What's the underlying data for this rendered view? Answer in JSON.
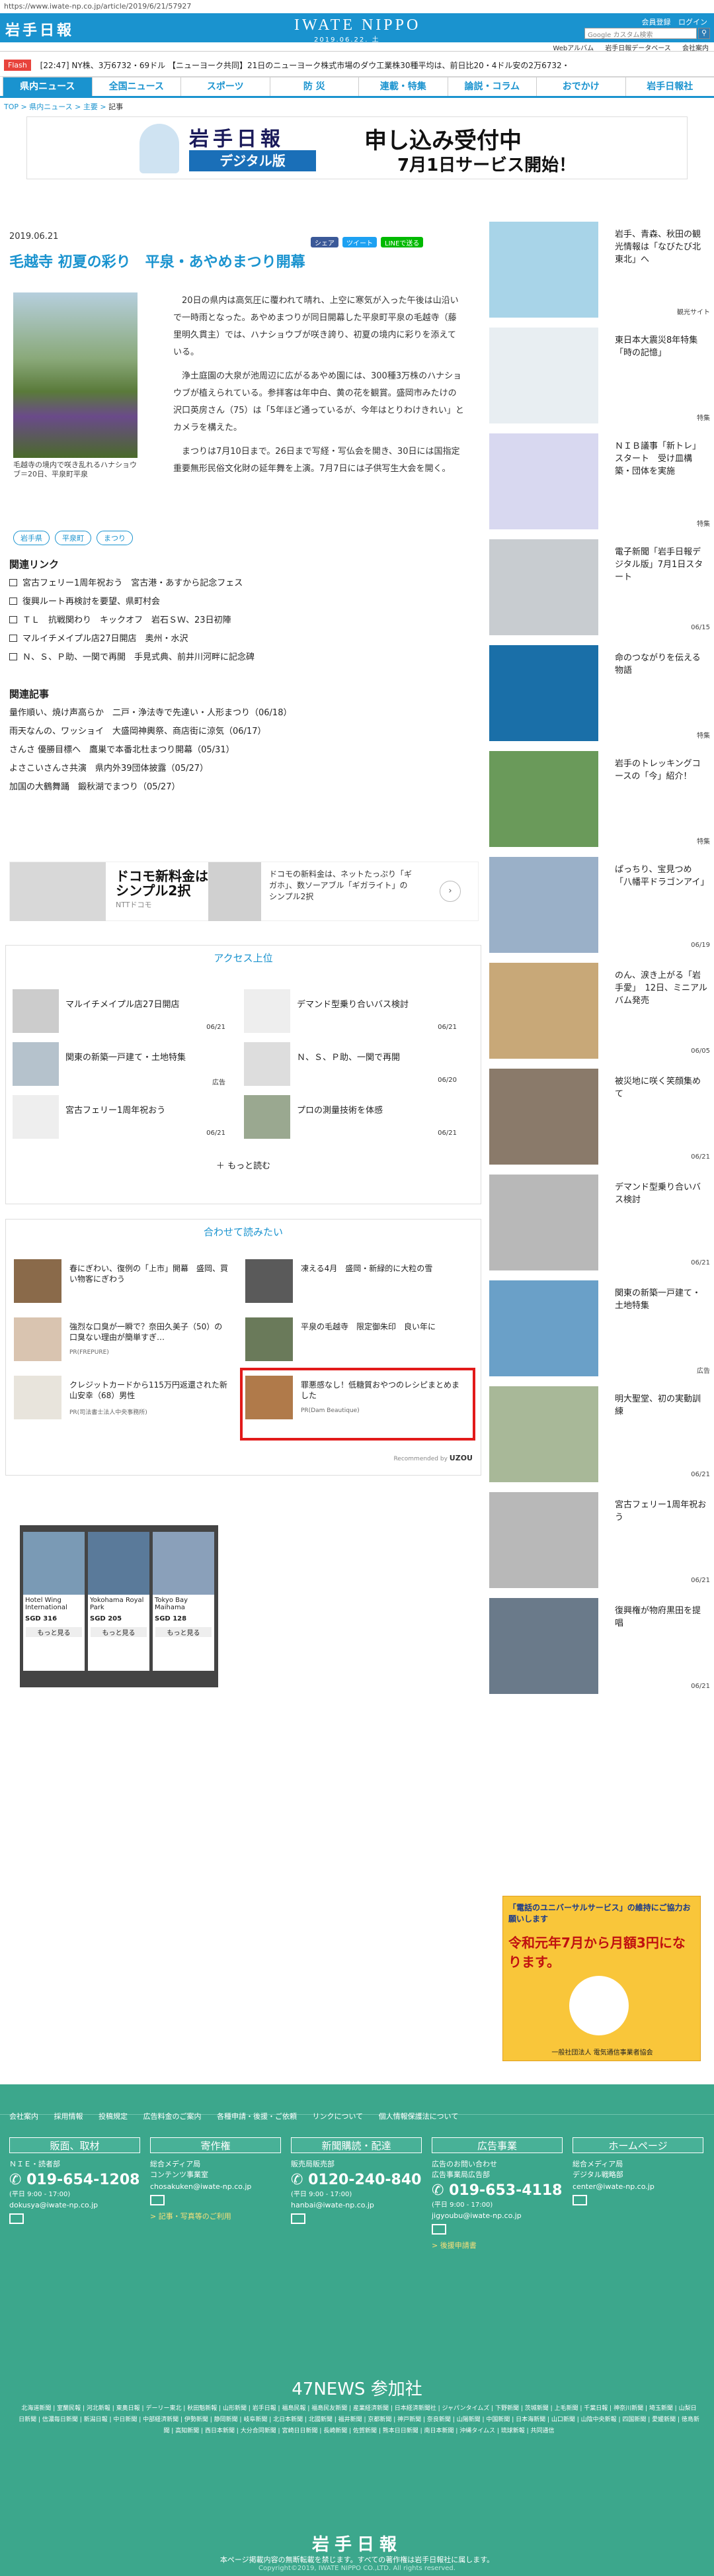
{
  "url": "https://www.iwate-np.co.jp/article/2019/6/21/57927",
  "header": {
    "logo": "岩手日報",
    "site_name": "IWATE NIPPO",
    "site_date": "2019.06.22. 土",
    "links": [
      "会員登録",
      "ログイン"
    ],
    "search_placeholder": "Google カスタム検索",
    "subnav": [
      "Webアルバム",
      "岩手日報データベース",
      "会社案内"
    ]
  },
  "ticker": {
    "flash": "Flash",
    "text": "[22:47] NY株、3万6732・69ドル 【ニューヨーク共同】21日のニューヨーク株式市場のダウ工業株30種平均は、前日比20・4ドル安の2万6732・"
  },
  "gnav": [
    "県内ニュース",
    "全国ニュース",
    "スポーツ",
    "防 災",
    "連載・特集",
    "論説・コラム",
    "おでかけ",
    "岩手日報社"
  ],
  "breadcrumb": {
    "items": [
      "TOP",
      "県内ニュース",
      "主要"
    ],
    "current": "記事"
  },
  "banner": {
    "logo": "岩手日報",
    "sub": "デジタル版",
    "headline": "申し込み受付中",
    "headline2": "7月1日サービス開始！"
  },
  "article": {
    "date": "2019.06.21",
    "share": [
      "シェア",
      "ツイート",
      "LINEで送る"
    ],
    "title": "毛越寺 初夏の彩り　平泉・あやめまつり開幕",
    "caption": "毛越寺の境内で咲き乱れるハナショウブ＝20日、平泉町平泉",
    "body": [
      "20日の県内は高気圧に覆われて晴れ、上空に寒気が入った午後は山沿いで一時雨となった。あやめまつりが同日開幕した平泉町平泉の毛越寺（藤里明久貫主）では、ハナショウブが咲き誇り、初夏の境内に彩りを添えている。",
      "浄土庭園の大泉が池周辺に広がるあやめ園には、300種3万株のハナショウブが植えられている。参拝客は年中白、黄の花を観賞。盛岡市みたけの沢口英房さん（75）は「5年ほど通っているが、今年はとりわけきれい」とカメラを構えた。",
      "まつりは7月10日まで。26日まで写経・写仏会を開き、30日には国指定重要無形民俗文化財の延年舞を上演。7月7日には子供写生大会を開く。"
    ],
    "tags": [
      "岩手県",
      "平泉町",
      "まつり"
    ]
  },
  "related_links": {
    "title": "関連リンク",
    "items": [
      "宮古フェリー1周年祝おう　宮古港・あすから記念フェス",
      "復興ルート再検討を要望、県町村会",
      "ＴＬ　抗戦関わり　キックオフ　岩石ＳＷ、23日初陣",
      "マルイチメイプル店27日開店　奥州・水沢",
      "Ｎ、Ｓ、Ｐ助、一関で再開　手見式典、前井川河畔に記念碑"
    ]
  },
  "related_articles": {
    "title": "関連記事",
    "items": [
      "量作順い、焼け声高らか　二戸・浄法寺で先達い・人形まつり（06/18）",
      "雨天なんの、ワッショイ　大盛岡神輿祭、商店街に涼気（06/17）",
      "さんさ 優勝目標へ　鷹巣で本番北杜まつり開幕（05/31）",
      "よさこいさんさ共演　県内外39団体披露（05/27）",
      "加国の大鶴舞踊　鍛秋湖でまつり（05/27）"
    ]
  },
  "ad": {
    "title": "ドコモ新料金は\nシンプル2択",
    "sponsor": "NTTドコモ",
    "right": "ドコモの新料金は、ネットたっぷり「ギガホ」、数ソーアブル「ギガライト」のシンプル2択"
  },
  "access": {
    "title": "アクセス上位",
    "items": [
      {
        "title": "マルイチメイプル店27日開店",
        "date": "06/21"
      },
      {
        "title": "デマンド型乗り合いバス検討",
        "date": "06/21"
      },
      {
        "title": "関東の新築一戸建て・土地特集",
        "date": "広告"
      },
      {
        "title": "Ｎ、Ｓ、Ｐ助、一関で再開",
        "date": "06/20"
      },
      {
        "title": "宮古フェリー1周年祝おう",
        "date": "06/21"
      },
      {
        "title": "プロの測量技術を体感",
        "date": "06/21"
      }
    ],
    "more": "もっと読む"
  },
  "recommend": {
    "title": "合わせて読みたい",
    "items": [
      {
        "title": "春にぎわい、復例の「上市」開幕　盛岡、買い物客にぎわう",
        "pr": ""
      },
      {
        "title": "凍える4月　盛岡・新緑的に大粒の雪",
        "pr": ""
      },
      {
        "title": "強烈な口臭が一瞬で？奈田久美子（50）の口臭ない理由が簡単すぎ…",
        "pr": "PR(FREPURE)"
      },
      {
        "title": "平泉の毛越寺　限定御朱印　良い年に",
        "pr": ""
      },
      {
        "title": "クレジットカードから115万円返還された新山安幸（68）男性",
        "pr": "PR(司法書士法人中央事務所)"
      },
      {
        "title": "罪悪感なし！低糖質おやつのレシピまとめました",
        "pr": "PR(Dam Beautique)"
      }
    ],
    "powered": "Recommended by",
    "uzou": "UZOU"
  },
  "hotel_ad": {
    "names": [
      "Hotel Wing International",
      "Yokohama Royal Park",
      "Tokyo Bay Maihama"
    ],
    "prices": [
      "SGD 316",
      "SGD 205",
      "SGD 128"
    ],
    "more": "もっと見る"
  },
  "sidebar": [
    {
      "title": "岩手、青森、秋田の観光情報は「なびたび北東北」へ",
      "date": "観光サイト"
    },
    {
      "title": "東日本大震災8年特集「時の記憶」",
      "date": "特集"
    },
    {
      "title": "ＮＩＢ議事「新トレ」スタート　受け皿構築・団体を実施",
      "date": "特集"
    },
    {
      "title": "電子新聞「岩手日報デジタル版」7月1日スタート",
      "date": "06/15"
    },
    {
      "title": "命のつながりを伝える物語",
      "date": "特集"
    },
    {
      "title": "岩手のトレッキングコースの「今」紹介！",
      "date": "特集"
    },
    {
      "title": "ぱっちり、宝見つめ　「八幡平ドラゴンアイ」",
      "date": "06/19"
    },
    {
      "title": "のん、涙き上がる「岩手愛」　12日、ミニアルバム発売",
      "date": "06/05"
    },
    {
      "title": "被災地に咲く笑顔集めて",
      "date": "06/21"
    },
    {
      "title": "デマンド型乗り合いバス検討",
      "date": "06/21"
    },
    {
      "title": "関東の新築一戸建て・土地特集",
      "date": "広告"
    },
    {
      "title": "明大聖堂、初の実動訓練",
      "date": "06/21"
    },
    {
      "title": "宮古フェリー1周年祝おう",
      "date": "06/21"
    },
    {
      "title": "復興権が物府黒田を提唱",
      "date": "06/21"
    }
  ],
  "side_ad": {
    "head": "「電話のユニバーサルサービス」の維持にご協力お願いします",
    "big": "令和元年7月から月額3円になります。",
    "foot": "一般社団法人 電気通信事業者協会"
  },
  "footer": {
    "nav": [
      "会社案内",
      "採用情報",
      "投稿規定",
      "広告料金のご案内",
      "各種申請・後援・ご依頼",
      "リンクについて",
      "個人情報保護法について"
    ],
    "cols": [
      {
        "head": "販面、取材",
        "sub": "ＮＩＥ・読者部",
        "num": "019-654-1208",
        "time": "(平日 9:00 - 17:00)",
        "mail": "dokusya@iwate-np.co.jp"
      },
      {
        "head": "寄作権",
        "sub": "総合メディア局\nコンテンツ事業室",
        "num": "",
        "time": "",
        "mail": "chosakuken@iwate-np.co.jp",
        "link": "> 記事・写真等のご利用"
      },
      {
        "head": "新聞購読・配達",
        "sub": "販売局販売部",
        "num": "0120-240-840",
        "time": "(平日 9:00 - 17:00)",
        "mail": "hanbai@iwate-np.co.jp"
      },
      {
        "head": "広告事業",
        "sub": "広告のお問い合わせ\n広告事業局広告部",
        "num": "019-653-4118",
        "time": "(平日 9:00 - 17:00)",
        "mail": "jigyoubu@iwate-np.co.jp",
        "link": "> 後援申請書"
      },
      {
        "head": "ホームページ",
        "sub": "総合メディア局\nデジタル戦略部",
        "num": "",
        "time": "",
        "mail": "center@iwate-np.co.jp"
      }
    ],
    "p47": "47NEWS 参加社",
    "papers": "北海道新聞 | 室蘭民報 | 河北新報 | 東奥日報 | デーリー東北 | 秋田魁新報 | 山形新聞 | 岩手日報 | 福島民報 | 福島民友新聞 | 産業経済新聞 | 日本経済新聞社 | ジャパンタイムズ | 下野新聞 | 茨城新聞 | 上毛新聞 | 千葉日報 | 神奈川新聞 | 埼玉新聞 | 山梨日日新聞 | 信濃毎日新聞 | 新潟日報 | 中日新聞 | 中部経済新聞 | 伊勢新聞 | 静岡新聞 | 岐阜新聞 | 北日本新聞 | 北國新聞 | 福井新聞 | 京都新聞 | 神戸新聞 | 奈良新聞 | 山陽新聞 | 中国新聞 | 日本海新聞 | 山口新聞 | 山陰中央新報 | 四国新聞 | 愛媛新聞 | 徳島新聞 | 高知新聞 | 西日本新聞 | 大分合同新聞 | 宮崎日日新聞 | 長崎新聞 | 佐賀新聞 | 熊本日日新聞 | 南日本新聞 | 沖縄タイムス | 琉球新報 | 共同通信",
    "logo": "岩手日報",
    "note": "本ページ掲載内容の無断転載を禁じます。すべての著作権は岩手日報社に属します。",
    "copy": "Copyright©2019, IWATE NIPPO CO.,LTD. All rights reserved."
  }
}
